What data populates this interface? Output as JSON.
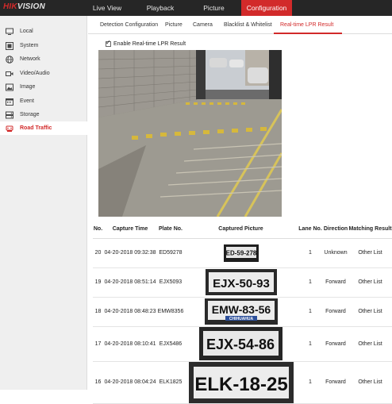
{
  "brand": {
    "hik": "HIK",
    "vision": "VISION"
  },
  "topnav": [
    {
      "label": "Live View"
    },
    {
      "label": "Playback"
    },
    {
      "label": "Picture"
    },
    {
      "label": "Configuration",
      "active": true
    }
  ],
  "sidebar": {
    "items": [
      {
        "label": "Local",
        "icon": "monitor-icon"
      },
      {
        "label": "System",
        "icon": "system-icon"
      },
      {
        "label": "Network",
        "icon": "globe-icon"
      },
      {
        "label": "Video/Audio",
        "icon": "video-icon"
      },
      {
        "label": "Image",
        "icon": "image-icon"
      },
      {
        "label": "Event",
        "icon": "calendar-icon"
      },
      {
        "label": "Storage",
        "icon": "storage-icon"
      },
      {
        "label": "Road Traffic",
        "icon": "traffic-icon",
        "active": true
      }
    ]
  },
  "tabs": [
    {
      "label": "Detection Configuration"
    },
    {
      "label": "Picture"
    },
    {
      "label": "Camera"
    },
    {
      "label": "Blacklist & Whitelist"
    },
    {
      "label": "Real-time LPR Result",
      "active": true
    }
  ],
  "enable_label": "Enable Real-time LPR Result",
  "enable_checked": true,
  "accent_color": "#d22a2a",
  "table": {
    "headers": {
      "no": "No.",
      "time": "Capture Time",
      "plate": "Plate No.",
      "picture": "Captured Picture",
      "lane": "Lane No.",
      "direction": "Direction",
      "result": "Matching Result"
    },
    "rows": [
      {
        "no": "20",
        "time": "04-20-2018 09:32:38",
        "plate": "ED59278",
        "picture_text": "ED-59-278",
        "picture_sub": "",
        "lane": "1",
        "direction": "Unknown",
        "result": "Other List"
      },
      {
        "no": "19",
        "time": "04-20-2018 08:51:14",
        "plate": "EJX5093",
        "picture_text": "EJX-50-93",
        "picture_sub": "",
        "lane": "1",
        "direction": "Forward",
        "result": "Other List"
      },
      {
        "no": "18",
        "time": "04-20-2018 08:48:23",
        "plate": "EMW8356",
        "picture_text": "EMW-83-56",
        "picture_sub": "CHIHUAHUA",
        "lane": "1",
        "direction": "Forward",
        "result": "Other List"
      },
      {
        "no": "17",
        "time": "04-20-2018 08:10:41",
        "plate": "EJX5486",
        "picture_text": "EJX-54-86",
        "picture_sub": "",
        "lane": "1",
        "direction": "Forward",
        "result": "Other List"
      },
      {
        "no": "16",
        "time": "04-20-2018 08:04:24",
        "plate": "ELK1825",
        "picture_text": "ELK-18-25",
        "picture_sub": "",
        "lane": "1",
        "direction": "Forward",
        "result": "Other List"
      }
    ]
  }
}
